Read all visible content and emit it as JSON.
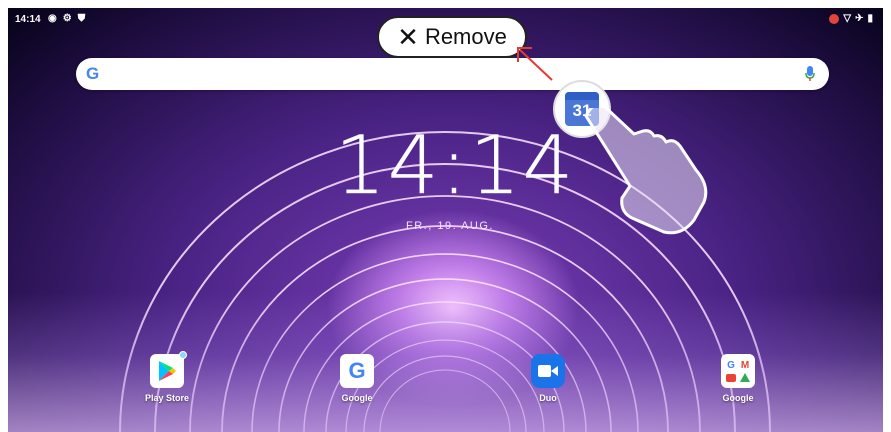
{
  "status_bar": {
    "time": "14:14",
    "left_icons": [
      "location-icon",
      "gear-icon",
      "shield-icon"
    ],
    "right_icons": [
      "record-icon",
      "wifi-icon",
      "airplane-icon",
      "battery-icon"
    ]
  },
  "drag_target": {
    "label": "Remove",
    "icon": "close-icon"
  },
  "search": {
    "logo": "G",
    "mic_icon": "mic-icon"
  },
  "clock": {
    "time": "14:14",
    "date": "FR., 19. AUG."
  },
  "dragged_app": {
    "icon": "calendar-icon",
    "day": "31"
  },
  "dock": [
    {
      "label": "Play Store",
      "icon": "play-store-icon"
    },
    {
      "label": "Google",
      "icon": "google-icon"
    },
    {
      "label": "Duo",
      "icon": "duo-icon"
    },
    {
      "label": "Google",
      "icon": "google-folder-icon"
    }
  ],
  "colors": {
    "accent_red": "#e53935",
    "search_blue": "#4285f4",
    "duo_blue": "#1a73e8"
  }
}
